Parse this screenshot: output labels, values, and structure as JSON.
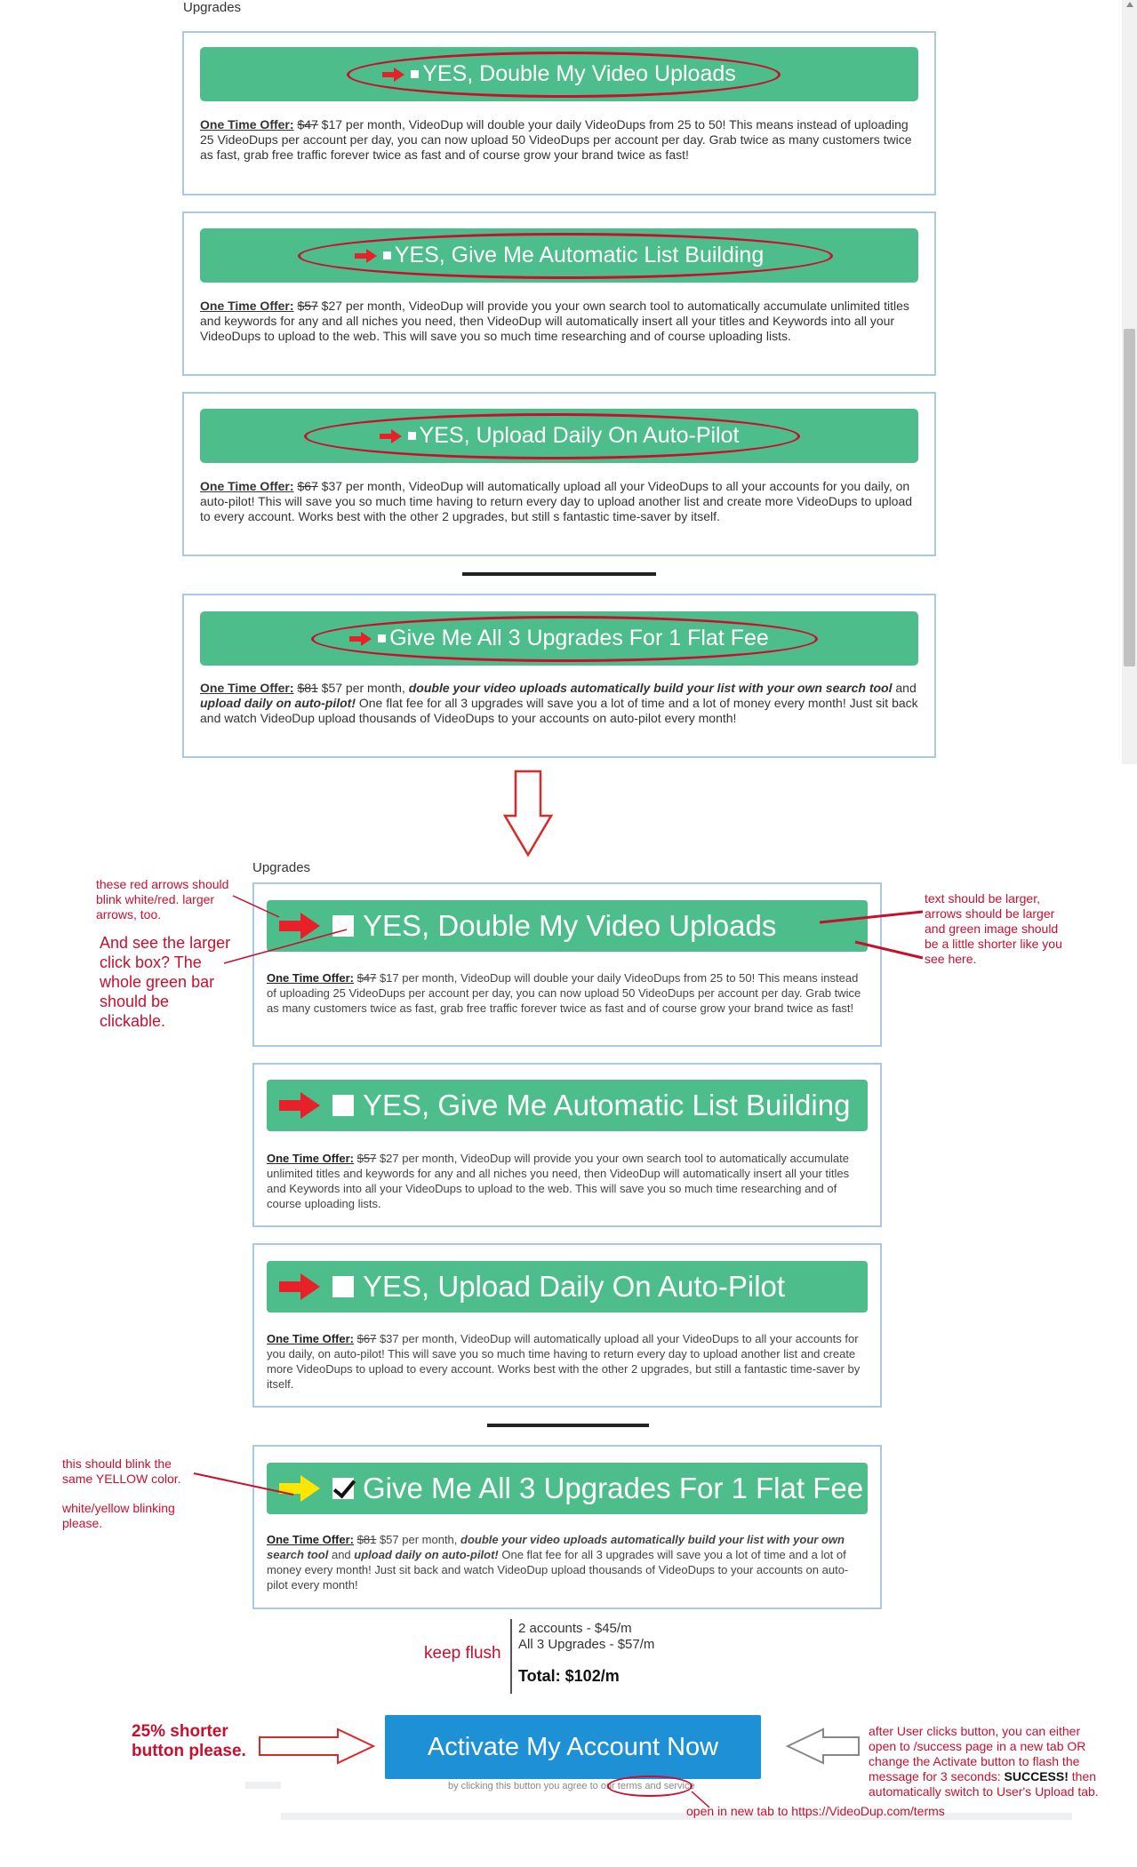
{
  "top": {
    "heading": "Upgrades",
    "upgrades": [
      {
        "label": "YES, Double My Video Uploads",
        "offer_title": "One Time Offer:",
        "old_price": "$47",
        "body": " $17 per month, VideoDup will double your daily VideoDups from 25 to 50! This means instead of uploading 25 VideoDups per account per day, you can now upload 50 VideoDups per account per day. Grab twice as many customers twice as fast, grab free traffic forever twice as fast and of course grow your brand twice as fast!"
      },
      {
        "label": "YES, Give Me Automatic List Building",
        "offer_title": "One Time Offer:",
        "old_price": "$57",
        "body": " $27 per month, VideoDup will provide you your own search tool to automatically accumulate unlimited titles and keywords for any and all niches you need, then VideoDup will automatically insert all your titles and Keywords into all your VideoDups to upload to the web. This will save you so much time researching and of course uploading lists."
      },
      {
        "label": "YES, Upload Daily On Auto-Pilot",
        "offer_title": "One Time Offer:",
        "old_price": "$67",
        "body": " $37 per month, VideoDup will automatically upload all your VideoDups to all your accounts for you daily, on auto-pilot! This will save you so much time having to return every day to upload another list and create more VideoDups to upload to every account. Works best with the other 2 upgrades, but still s fantastic time-saver by itself."
      }
    ],
    "bundle": {
      "label": "Give Me All 3 Upgrades For 1 Flat Fee",
      "offer_title": "One Time Offer:",
      "old_price": "$81",
      "price": " $57 per month, ",
      "bold1": "double your video uploads automatically build your list with your own search tool",
      "mid": " and ",
      "bold2": "upload daily on auto-pilot!",
      "rest": " One flat fee for all 3 upgrades will save you a lot of time and a lot of money every month! Just sit back and watch VideoDup upload thousands of VideoDups to your accounts on auto-pilot every month!"
    }
  },
  "bottom": {
    "heading": "Upgrades",
    "upgrades": [
      {
        "label": "YES, Double My Video Uploads",
        "offer_title": "One Time Offer:",
        "old_price": "$47",
        "body": " $17 per month, VideoDup will double your daily VideoDups from 25 to 50! This means instead of uploading 25 VideoDups per account per day, you can now upload 50 VideoDups per account per day. Grab twice as many customers twice as fast, grab free traffic forever twice as fast and of course grow your brand twice as fast!"
      },
      {
        "label": "YES, Give Me Automatic List Building",
        "offer_title": "One Time Offer:",
        "old_price": "$57",
        "body": " $27 per month, VideoDup will provide you your own search tool to automatically accumulate unlimited titles and keywords for any and all niches you need, then VideoDup will automatically insert all your titles and Keywords into all your VideoDups to upload to the web. This will save you so much time researching and of course uploading lists."
      },
      {
        "label": "YES, Upload Daily On Auto-Pilot",
        "offer_title": "One Time Offer:",
        "old_price": "$67",
        "body": " $37 per month, VideoDup will automatically upload all your VideoDups to all your accounts for you daily, on auto-pilot! This will save you so much time having to return every day to upload another list and create more VideoDups to upload to every account. Works best with the other 2 upgrades, but still a fantastic time-saver by itself."
      }
    ],
    "bundle": {
      "label": "Give Me All 3 Upgrades For 1 Flat Fee",
      "offer_title": "One Time Offer:",
      "old_price": "$81",
      "price": " $57 per month, ",
      "bold1": "double your video uploads automatically build your list with your own search tool",
      "mid": " and ",
      "bold2": "upload daily on auto-pilot!",
      "rest": " One flat fee for all 3 upgrades will save you a lot of time and a lot of money every month! Just sit back and watch VideoDup upload thousands of VideoDups to your accounts on auto-pilot every month!"
    },
    "summary": {
      "line1": "2 accounts - $45/m",
      "line2": "All 3 Upgrades - $57/m",
      "total": "Total: $102/m"
    },
    "activate_label": "Activate My Account Now",
    "terms_prefix": "by clicking this button you agree to our ",
    "terms_link": "terms and service"
  },
  "notes": {
    "red_arrows": "these red arrows should blink white/red. larger arrows, too.",
    "click_box": "And see the larger click box? The whole green bar should be clickable.",
    "text_larger": "text should be larger, arrows should be larger and green image should be a little shorter like you see here.",
    "yellow1": "this should blink the same YELLOW color.",
    "yellow2": "white/yellow blinking please.",
    "keep_flush": "keep flush",
    "shorter_button": "25% shorter button please.",
    "after_click_pre": "after User clicks button, you can either open to /success page in a new tab OR change the Activate button to flash the message for 3 seconds: ",
    "after_click_bold": "SUCCESS!",
    "after_click_post": " then automatically switch to User's Upload tab.",
    "terms_new_tab": "open in new tab to https://VideoDup.com/terms"
  },
  "colors": {
    "green": "#4dbd8c",
    "red": "#e8202a",
    "note_red": "#c8102e",
    "box_border": "#a8c9e6",
    "activate_blue": "#1e90d6",
    "yellow": "#ffe600"
  }
}
